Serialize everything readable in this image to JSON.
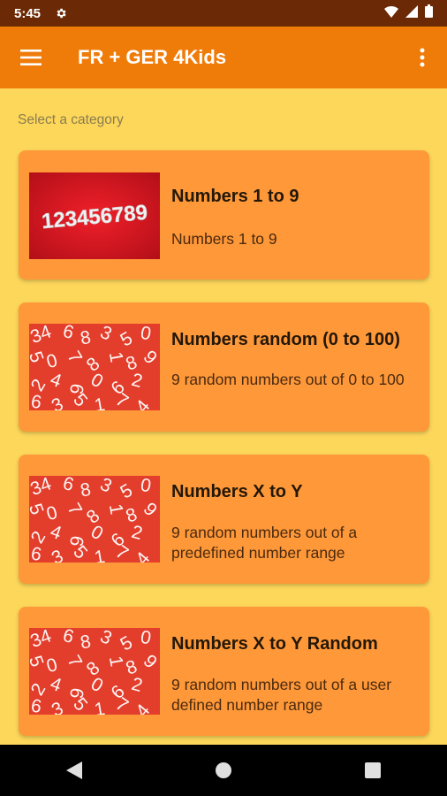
{
  "status_bar": {
    "time": "5:45"
  },
  "app_bar": {
    "title": "FR + GER 4Kids"
  },
  "subtitle": "Select a category",
  "categories": [
    {
      "title": "Numbers 1 to 9",
      "description": "Numbers 1 to 9",
      "image_text": "123456789"
    },
    {
      "title": "Numbers random (0 to 100)",
      "description": "9 random numbers out of 0 to 100"
    },
    {
      "title": "Numbers X to Y",
      "description": "9 random numbers out of a predefined number range"
    },
    {
      "title": "Numbers X to Y Random",
      "description": "9 random numbers out of a user defined number range"
    }
  ],
  "colors": {
    "status_bar": "#6B2A05",
    "app_bar": "#EF7B09",
    "background": "#FDD75A",
    "card": "#FF9838",
    "thumb_red": "#E33D2B"
  },
  "icons": {
    "menu": "hamburger-menu-icon",
    "more": "more-vert-icon",
    "wifi": "wifi-icon",
    "signal": "signal-icon",
    "battery": "battery-icon",
    "settings": "gear-icon",
    "back": "nav-back-icon",
    "home": "nav-home-icon",
    "recents": "nav-recents-icon"
  }
}
